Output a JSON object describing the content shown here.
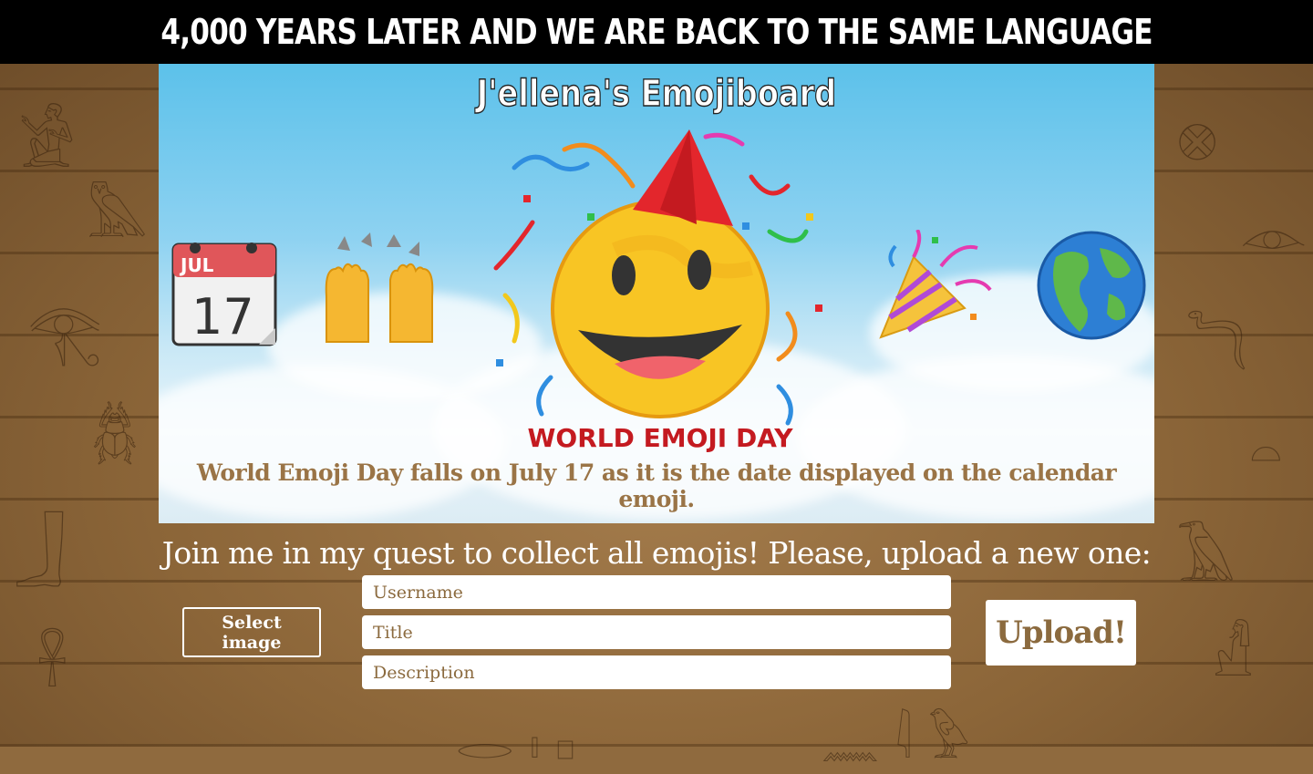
{
  "banner": {
    "title": "4,000 YEARS LATER AND WE ARE BACK TO THE SAME LANGUAGE"
  },
  "hero": {
    "board_title": "J'ellena's  Emojiboard",
    "caption": "World Emoji Day falls on July 17 as it is the date displayed on the calendar emoji.",
    "calendar": {
      "month": "JUL",
      "day": "17"
    },
    "badge_text": "WORLD EMOJI DAY",
    "emojis": [
      "calendar-icon",
      "raising-hands-icon",
      "party-face-icon",
      "party-popper-icon",
      "globe-icon"
    ]
  },
  "upload": {
    "prompt": "Join me in my quest to collect all emojis! Please, upload a new one:",
    "select_label": "Select image",
    "username_placeholder": "Username",
    "title_placeholder": "Title",
    "description_placeholder": "Description",
    "submit_label": "Upload!"
  },
  "colors": {
    "banner_bg": "#000000",
    "accent_brown": "#8b6a3e",
    "caption_brown": "#9a7446"
  }
}
